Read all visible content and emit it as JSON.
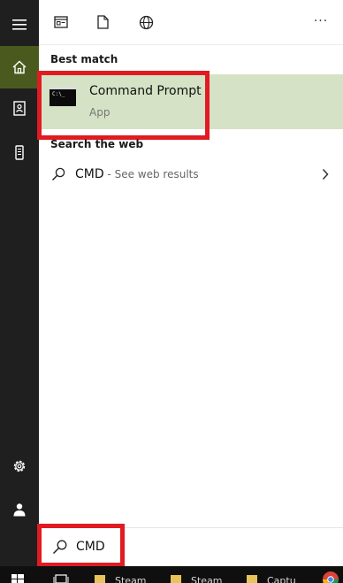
{
  "toolbar": {
    "apps_icon": "apps-icon",
    "documents_icon": "document-icon",
    "web_icon": "globe-icon",
    "more_label": "···"
  },
  "sidebar": {
    "items": [
      {
        "icon": "hamburger-icon"
      },
      {
        "icon": "home-icon",
        "active": true
      },
      {
        "icon": "notebook-icon"
      },
      {
        "icon": "phone-icon"
      },
      {
        "icon": "settings-icon"
      },
      {
        "icon": "user-icon"
      }
    ]
  },
  "results": {
    "best_match_heading": "Best match",
    "best_match": {
      "title": "Command Prompt",
      "subtitle": "App",
      "icon_text": "C:\\_"
    },
    "web_heading": "Search the web",
    "web_item": {
      "query": "CMD",
      "suffix": " - See web results"
    }
  },
  "search": {
    "value": "CMD"
  },
  "taskbar": {
    "items": [
      "Steam",
      "Steam",
      "Captu"
    ]
  },
  "colors": {
    "highlight": "#e01b22",
    "best_match_bg": "#d5e2c5",
    "rail_active": "#4a5a1f"
  }
}
